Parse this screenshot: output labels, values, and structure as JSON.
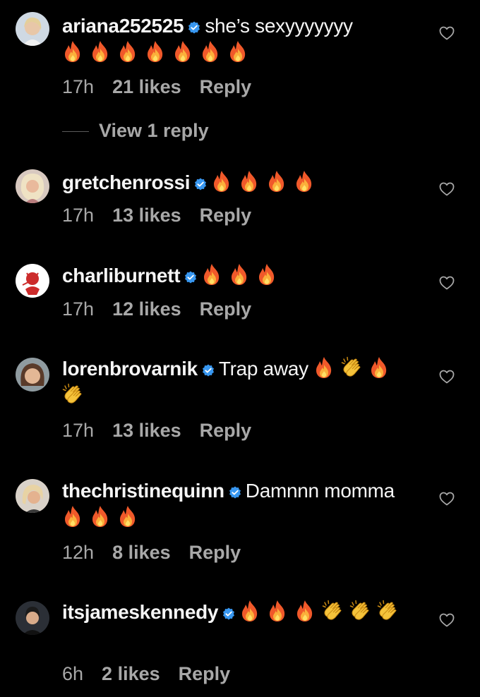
{
  "colors": {
    "background": "#000000",
    "text": "#f5f5f5",
    "secondary": "#a8a8a8",
    "verified": "#3897f0"
  },
  "view_replies_label": "View 1 reply",
  "comments": [
    {
      "username": "ariana252525",
      "text": "she’s sexyyyyyyy",
      "emojis": [
        "fire",
        "fire",
        "fire",
        "fire",
        "fire",
        "fire",
        "fire"
      ],
      "time": "17h",
      "likes": "21 likes",
      "reply": "Reply"
    },
    {
      "username": "gretchenrossi",
      "text": "",
      "emojis": [
        "fire",
        "fire",
        "fire",
        "fire"
      ],
      "time": "17h",
      "likes": "13 likes",
      "reply": "Reply"
    },
    {
      "username": "charliburnett",
      "text": "",
      "emojis": [
        "fire",
        "fire",
        "fire"
      ],
      "time": "17h",
      "likes": "12 likes",
      "reply": "Reply"
    },
    {
      "username": "lorenbrovarnik",
      "text": "Trap away",
      "emojis": [
        "fire",
        "clap",
        "fire",
        "clap"
      ],
      "time": "17h",
      "likes": "13 likes",
      "reply": "Reply"
    },
    {
      "username": "thechristinequinn",
      "text": "Damnnn momma",
      "emojis": [
        "fire",
        "fire",
        "fire"
      ],
      "time": "12h",
      "likes": "8 likes",
      "reply": "Reply"
    },
    {
      "username": "itsjameskennedy",
      "text": "",
      "emojis": [
        "fire",
        "fire",
        "fire",
        "clap",
        "clap",
        "clap"
      ],
      "time": "6h",
      "likes": "2 likes",
      "reply": "Reply"
    }
  ]
}
